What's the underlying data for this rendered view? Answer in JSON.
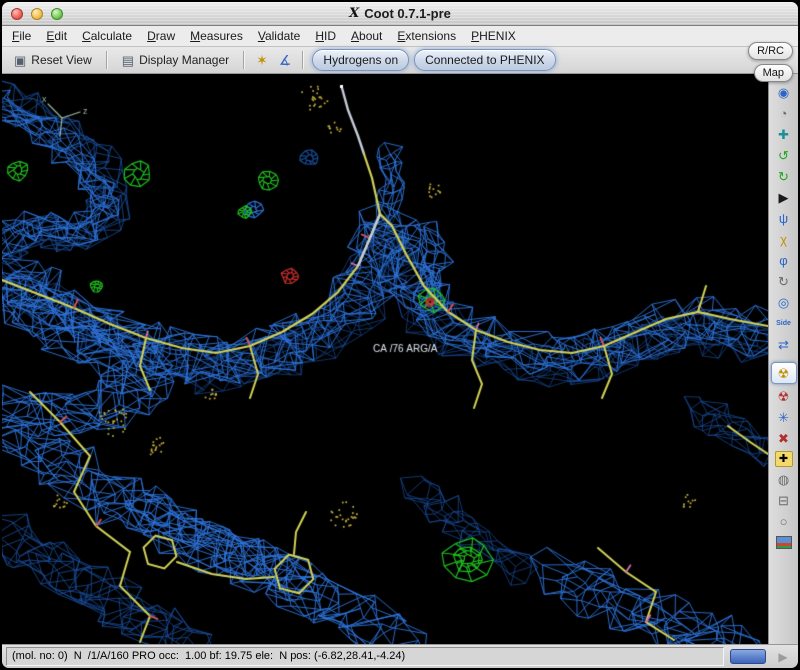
{
  "window": {
    "title": "Coot 0.7.1-pre"
  },
  "menubar": {
    "items": [
      {
        "label": "File"
      },
      {
        "label": "Edit"
      },
      {
        "label": "Calculate"
      },
      {
        "label": "Draw"
      },
      {
        "label": "Measures"
      },
      {
        "label": "Validate"
      },
      {
        "label": "HID"
      },
      {
        "label": "About"
      },
      {
        "label": "Extensions"
      },
      {
        "label": "PHENIX"
      }
    ]
  },
  "toolbar": {
    "reset_view_label": "Reset View",
    "display_manager_label": "Display Manager",
    "hydrogens_label": "Hydrogens on",
    "phenix_label": "Connected to PHENIX"
  },
  "floating": {
    "rrc_label": "R/RC",
    "map_label": "Map"
  },
  "sidebar": {
    "side_label": "Side"
  },
  "canvas": {
    "residue_label": "CA /76 ARG/A",
    "axis_x": "x",
    "axis_z": "z",
    "colors": {
      "mesh": "#2d74dd",
      "mesh_dim": "#1a4f9e",
      "green": "#21c421",
      "red": "#d03030",
      "stick": "#d2d258",
      "stick_light": "#c6cdd8",
      "dots": "#c9b23a",
      "label": "#dfe5ec",
      "axes": "#9fb89f",
      "tick_red": "#dd5555",
      "tick_pink": "#d470b0"
    }
  },
  "statusbar": {
    "text": "(mol. no: 0)  N  /1/A/160 PRO occ:  1.00 bf: 19.75 ele:  N pos: (-6.82,28.41,-4.24)"
  },
  "icons": {
    "x11": "X",
    "reset_view": "▣",
    "display_manager": "▤",
    "goto_atom": "✶",
    "measure": "∡",
    "spin": "◉",
    "idle": "◔",
    "rot_trans": "✚",
    "undo": "↺",
    "redo": "↻",
    "run": "▶",
    "rotamers": "ψ",
    "chi": "χ",
    "torsion": "φ",
    "rotate_zone": "↻",
    "goto_residue": "◎",
    "flip": "⇄",
    "refine": "☢",
    "regularize": "☢",
    "pepflip": "✳",
    "autofit": "✖",
    "add_res": "✚",
    "mutate": "◍",
    "delete": "⊟",
    "sphere": "○",
    "play": "▶"
  }
}
